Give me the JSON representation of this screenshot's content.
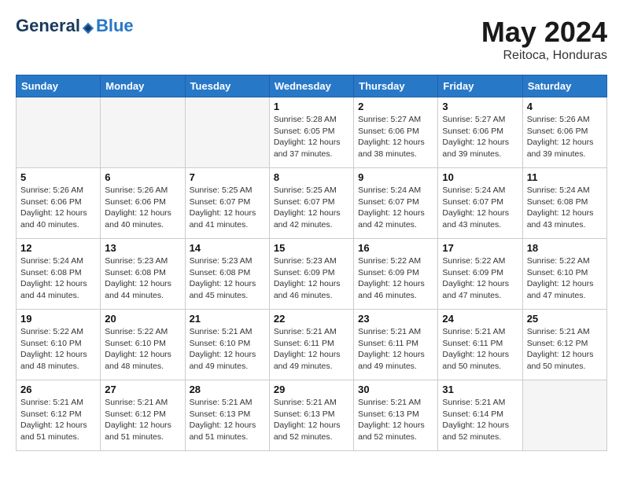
{
  "header": {
    "logo": {
      "general": "General",
      "blue": "Blue"
    },
    "title": "May 2024",
    "location": "Reitoca, Honduras"
  },
  "days_of_week": [
    "Sunday",
    "Monday",
    "Tuesday",
    "Wednesday",
    "Thursday",
    "Friday",
    "Saturday"
  ],
  "weeks": [
    [
      {
        "day": "",
        "info": ""
      },
      {
        "day": "",
        "info": ""
      },
      {
        "day": "",
        "info": ""
      },
      {
        "day": "1",
        "info": "Sunrise: 5:28 AM\nSunset: 6:05 PM\nDaylight: 12 hours\nand 37 minutes."
      },
      {
        "day": "2",
        "info": "Sunrise: 5:27 AM\nSunset: 6:06 PM\nDaylight: 12 hours\nand 38 minutes."
      },
      {
        "day": "3",
        "info": "Sunrise: 5:27 AM\nSunset: 6:06 PM\nDaylight: 12 hours\nand 39 minutes."
      },
      {
        "day": "4",
        "info": "Sunrise: 5:26 AM\nSunset: 6:06 PM\nDaylight: 12 hours\nand 39 minutes."
      }
    ],
    [
      {
        "day": "5",
        "info": "Sunrise: 5:26 AM\nSunset: 6:06 PM\nDaylight: 12 hours\nand 40 minutes."
      },
      {
        "day": "6",
        "info": "Sunrise: 5:26 AM\nSunset: 6:06 PM\nDaylight: 12 hours\nand 40 minutes."
      },
      {
        "day": "7",
        "info": "Sunrise: 5:25 AM\nSunset: 6:07 PM\nDaylight: 12 hours\nand 41 minutes."
      },
      {
        "day": "8",
        "info": "Sunrise: 5:25 AM\nSunset: 6:07 PM\nDaylight: 12 hours\nand 42 minutes."
      },
      {
        "day": "9",
        "info": "Sunrise: 5:24 AM\nSunset: 6:07 PM\nDaylight: 12 hours\nand 42 minutes."
      },
      {
        "day": "10",
        "info": "Sunrise: 5:24 AM\nSunset: 6:07 PM\nDaylight: 12 hours\nand 43 minutes."
      },
      {
        "day": "11",
        "info": "Sunrise: 5:24 AM\nSunset: 6:08 PM\nDaylight: 12 hours\nand 43 minutes."
      }
    ],
    [
      {
        "day": "12",
        "info": "Sunrise: 5:24 AM\nSunset: 6:08 PM\nDaylight: 12 hours\nand 44 minutes."
      },
      {
        "day": "13",
        "info": "Sunrise: 5:23 AM\nSunset: 6:08 PM\nDaylight: 12 hours\nand 44 minutes."
      },
      {
        "day": "14",
        "info": "Sunrise: 5:23 AM\nSunset: 6:08 PM\nDaylight: 12 hours\nand 45 minutes."
      },
      {
        "day": "15",
        "info": "Sunrise: 5:23 AM\nSunset: 6:09 PM\nDaylight: 12 hours\nand 46 minutes."
      },
      {
        "day": "16",
        "info": "Sunrise: 5:22 AM\nSunset: 6:09 PM\nDaylight: 12 hours\nand 46 minutes."
      },
      {
        "day": "17",
        "info": "Sunrise: 5:22 AM\nSunset: 6:09 PM\nDaylight: 12 hours\nand 47 minutes."
      },
      {
        "day": "18",
        "info": "Sunrise: 5:22 AM\nSunset: 6:10 PM\nDaylight: 12 hours\nand 47 minutes."
      }
    ],
    [
      {
        "day": "19",
        "info": "Sunrise: 5:22 AM\nSunset: 6:10 PM\nDaylight: 12 hours\nand 48 minutes."
      },
      {
        "day": "20",
        "info": "Sunrise: 5:22 AM\nSunset: 6:10 PM\nDaylight: 12 hours\nand 48 minutes."
      },
      {
        "day": "21",
        "info": "Sunrise: 5:21 AM\nSunset: 6:10 PM\nDaylight: 12 hours\nand 49 minutes."
      },
      {
        "day": "22",
        "info": "Sunrise: 5:21 AM\nSunset: 6:11 PM\nDaylight: 12 hours\nand 49 minutes."
      },
      {
        "day": "23",
        "info": "Sunrise: 5:21 AM\nSunset: 6:11 PM\nDaylight: 12 hours\nand 49 minutes."
      },
      {
        "day": "24",
        "info": "Sunrise: 5:21 AM\nSunset: 6:11 PM\nDaylight: 12 hours\nand 50 minutes."
      },
      {
        "day": "25",
        "info": "Sunrise: 5:21 AM\nSunset: 6:12 PM\nDaylight: 12 hours\nand 50 minutes."
      }
    ],
    [
      {
        "day": "26",
        "info": "Sunrise: 5:21 AM\nSunset: 6:12 PM\nDaylight: 12 hours\nand 51 minutes."
      },
      {
        "day": "27",
        "info": "Sunrise: 5:21 AM\nSunset: 6:12 PM\nDaylight: 12 hours\nand 51 minutes."
      },
      {
        "day": "28",
        "info": "Sunrise: 5:21 AM\nSunset: 6:13 PM\nDaylight: 12 hours\nand 51 minutes."
      },
      {
        "day": "29",
        "info": "Sunrise: 5:21 AM\nSunset: 6:13 PM\nDaylight: 12 hours\nand 52 minutes."
      },
      {
        "day": "30",
        "info": "Sunrise: 5:21 AM\nSunset: 6:13 PM\nDaylight: 12 hours\nand 52 minutes."
      },
      {
        "day": "31",
        "info": "Sunrise: 5:21 AM\nSunset: 6:14 PM\nDaylight: 12 hours\nand 52 minutes."
      },
      {
        "day": "",
        "info": ""
      }
    ]
  ]
}
